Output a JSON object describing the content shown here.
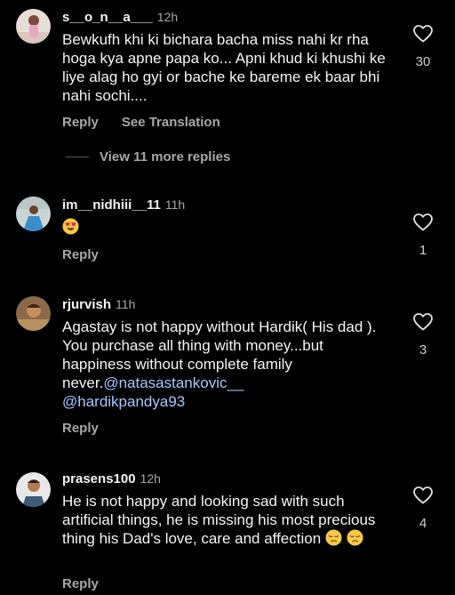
{
  "comments": [
    {
      "username": "s__o_n__a___",
      "time": "12h",
      "text": "Bewkufh khi ki bichara bacha miss nahi kr rha hoga kya apne papa ko... Apni khud ki khushi ke liye alag ho gyi or bache ke bareme ek baar bhi nahi sochi....",
      "reply_label": "Reply",
      "translate_label": "See Translation",
      "like_count": "30",
      "view_replies_label": "View 11 more replies"
    },
    {
      "username": "im__nidhiii__11",
      "time": "11h",
      "emoji": "heart-eyes-emoji",
      "reply_label": "Reply",
      "like_count": "1"
    },
    {
      "username": "rjurvish",
      "time": "11h",
      "text": "Agastay is not happy  without  Hardik( His dad ). You purchase all thing with money...but happiness without  complete family never.",
      "mention1": "@natasastankovic__",
      "mention2": "@hardikpandya93",
      "reply_label": "Reply",
      "like_count": "3"
    },
    {
      "username": "prasens100",
      "time": "12h",
      "text": "He is not happy and looking sad with such artificial things, he is missing his most precious thing his Dad's love, care and affection",
      "emoji": "pensive-emoji",
      "reply_label": "Reply",
      "like_count": "4"
    }
  ],
  "colors": {
    "background": "#000000",
    "text": "#f5f5f5",
    "secondary": "#a8a8a8",
    "mention": "#a5c8ff"
  }
}
